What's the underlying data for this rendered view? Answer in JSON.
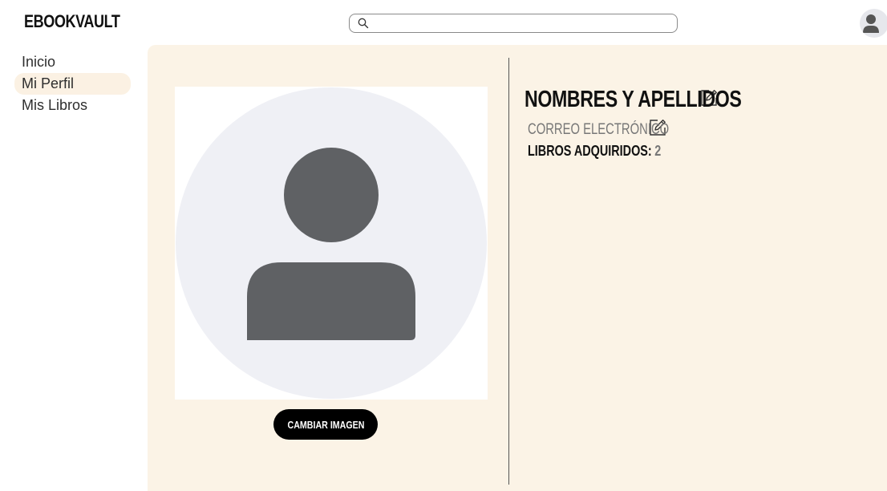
{
  "app": {
    "title": "EBOOKVAULT"
  },
  "search": {
    "placeholder": "",
    "value": ""
  },
  "sidebar": {
    "items": [
      {
        "label": "Inicio",
        "active": false
      },
      {
        "label": "Mi Perfil",
        "active": true
      },
      {
        "label": "Mis Libros",
        "active": false
      }
    ]
  },
  "profile": {
    "name": "NOMBRES Y APELLIDOS",
    "email": "CORREO ELECTRÓNICO",
    "books_label": "LIBROS ADQUIRIDOS:",
    "books_count": "2",
    "change_image_label": "CAMBIAR IMAGEN"
  },
  "icons": {
    "search": "search-icon",
    "user": "user-icon",
    "edit": "edit-icon",
    "avatar_placeholder": "avatar-placeholder-icon"
  },
  "colors": {
    "panel_bg": "#fbf3e6",
    "active_nav_bg": "#fbf1e3",
    "avatar_bg": "#eff0f5",
    "avatar_fg": "#5f6164",
    "button_bg": "#000000",
    "muted_text": "#777777"
  }
}
